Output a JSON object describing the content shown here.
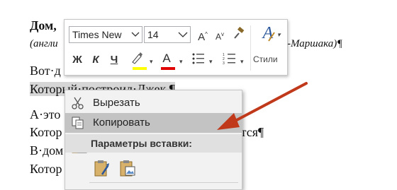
{
  "document": {
    "title": "Дом,",
    "subtitle_left": "(англи",
    "subtitle_right": "-Маршака)¶",
    "lines": [
      "Вот·д",
      "Который·построил·Джек.¶",
      "А·это",
      "Котор",
      "В·дом",
      "Котор"
    ],
    "line4_right": "ится¶"
  },
  "mini_toolbar": {
    "font_name": "Times New",
    "font_size": "14",
    "grow_font_glyph": "A",
    "shrink_font_glyph": "A",
    "bold_label": "Ж",
    "italic_label": "К",
    "underline_label": "Ч",
    "font_color_glyph": "A",
    "styles_glyph": "A",
    "styles_label": "Стили",
    "highlight_color": "#ffff00",
    "font_color": "#e00000"
  },
  "context_menu": {
    "items": [
      {
        "label": "Вырезать",
        "icon": "scissors-icon"
      },
      {
        "label": "Копировать",
        "icon": "copy-icon"
      }
    ],
    "paste_header": "Параметры вставки:",
    "paste_options": [
      "paste-keep-formatting-icon",
      "paste-picture-icon"
    ]
  },
  "colors": {
    "selection_highlight": "#d6d6d6",
    "menu_hover": "#c3c3c3",
    "arrow": "#c0391b",
    "styles_accent": "#2b579a"
  }
}
